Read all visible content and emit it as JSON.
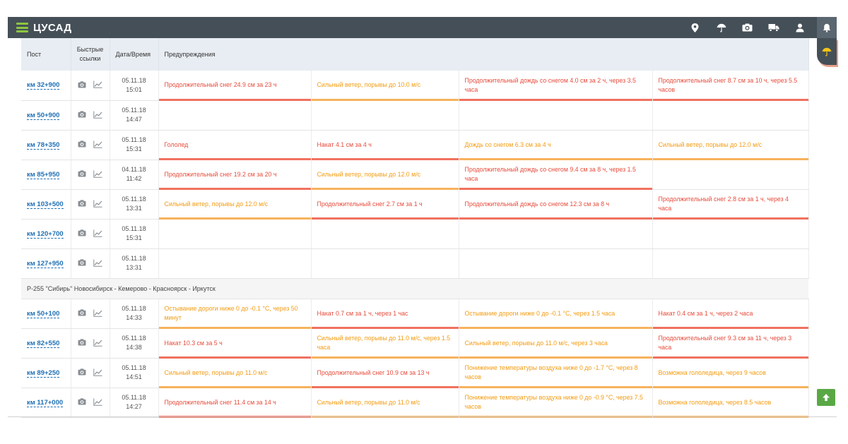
{
  "app": {
    "title": "ЦУСАД"
  },
  "topbar": {
    "icons": [
      "location-pin-icon",
      "umbrella-icon",
      "camera-icon",
      "truck-icon",
      "user-icon",
      "bell-icon"
    ]
  },
  "table": {
    "headers": {
      "post": "Пост",
      "links": "Быстрые ссылки",
      "datetime": "Дата/Время",
      "warnings": "Предупреждения"
    },
    "rows_a": [
      {
        "post": "км 32+900",
        "date": "05.11.18",
        "time": "15:01",
        "warnings": [
          {
            "text": "Продолжительный снег 24.9 см за 23 ч",
            "level": "red"
          },
          {
            "text": "Сильный ветер, порывы до 10.0 м/с",
            "level": "orange"
          },
          {
            "text": "Продолжительный дождь со снегом 4.0 см за 2 ч, через 3.5 часа",
            "level": "red"
          },
          {
            "text": "Продолжительный снег 8.7 см за 10 ч, через 5.5 часов",
            "level": "red"
          }
        ]
      },
      {
        "post": "км 50+900",
        "date": "05.11.18",
        "time": "14:47",
        "warnings": []
      },
      {
        "post": "км 78+350",
        "date": "05.11.18",
        "time": "15:31",
        "warnings": [
          {
            "text": "Гололед",
            "level": "red"
          },
          {
            "text": "Накат 4.1 см за 4 ч",
            "level": "red"
          },
          {
            "text": "Дождь со снегом 6.3 см за 4 ч",
            "level": "orange"
          },
          {
            "text": "Сильный ветер, порывы до 12.0 м/с",
            "level": "orange"
          }
        ]
      },
      {
        "post": "км 85+950",
        "date": "04.11.18",
        "time": "11:42",
        "warnings": [
          {
            "text": "Продолжительный снег 19.2 см за 20 ч",
            "level": "red"
          },
          {
            "text": "Сильный ветер, порывы до 12.0 м/с",
            "level": "orange"
          },
          {
            "text": "Продолжительный дождь со снегом 9.4 см за 8 ч, через 1.5 часа",
            "level": "red"
          }
        ]
      },
      {
        "post": "км 103+500",
        "date": "05.11.18",
        "time": "13:31",
        "warnings": [
          {
            "text": "Сильный ветер, порывы до 12.0 м/с",
            "level": "orange"
          },
          {
            "text": "Продолжительный снег 2.7 см за 1 ч",
            "level": "red"
          },
          {
            "text": "Продолжительный дождь со снегом 12.3 см за 8 ч",
            "level": "red"
          },
          {
            "text": "Продолжительный снег 2.8 см за 1 ч, через 4 часа",
            "level": "red"
          }
        ]
      },
      {
        "post": "км 120+700",
        "date": "05.11.18",
        "time": "15:31",
        "warnings": []
      },
      {
        "post": "км 127+950",
        "date": "05.11.18",
        "time": "13:31",
        "warnings": []
      }
    ],
    "section_title": "Р-255 \"Сибирь\" Новосибирск - Кемерово - Красноярск - Иркутск",
    "rows_b": [
      {
        "post": "км 50+100",
        "date": "05.11.18",
        "time": "14:33",
        "warnings": [
          {
            "text": "Остывание дороги ниже 0 до -0.1 °С, через 50 минут",
            "level": "orange"
          },
          {
            "text": "Накат 0.7 см за 1 ч, через 1 час",
            "level": "red"
          },
          {
            "text": "Остывание дороги ниже 0 до -0.1 °С, через 1.5 часа",
            "level": "orange"
          },
          {
            "text": "Накат 0.4 см за 1 ч, через 2 часа",
            "level": "red"
          }
        ]
      },
      {
        "post": "км 82+550",
        "date": "05.11.18",
        "time": "14:38",
        "warnings": [
          {
            "text": "Накат 10.3 см за 5 ч",
            "level": "red"
          },
          {
            "text": "Сильный ветер, порывы до 11.0 м/с, через 1.5 часа",
            "level": "orange"
          },
          {
            "text": "Сильный ветер, порывы до 11.0 м/с, через 3 часа",
            "level": "orange"
          },
          {
            "text": "Продолжительный снег 9.3 см за 11 ч, через 3 часа",
            "level": "red"
          }
        ]
      },
      {
        "post": "км 89+250",
        "date": "05.11.18",
        "time": "14:51",
        "warnings": [
          {
            "text": "Сильный ветер, порывы до 11.0 м/с",
            "level": "orange"
          },
          {
            "text": "Продолжительный снег 10.9 см за 13 ч",
            "level": "red"
          },
          {
            "text": "Понижение температуры воздуха ниже 0 до -1.7 °С, через 8 часов",
            "level": "orange"
          },
          {
            "text": "Возможна гололедица, через 9 часов",
            "level": "orange"
          }
        ]
      },
      {
        "post": "км 117+000",
        "date": "05.11.18",
        "time": "14:27",
        "warnings": [
          {
            "text": "Продолжительный снег 11.4 см за 14 ч",
            "level": "red"
          },
          {
            "text": "Сильный ветер, порывы до 11.0 м/с",
            "level": "orange"
          },
          {
            "text": "Понижение температуры воздуха ниже 0 до -0.9 °С, через 7.5 часов",
            "level": "orange"
          },
          {
            "text": "Возможна гололедица, через 8.5 часов",
            "level": "orange"
          }
        ]
      }
    ]
  },
  "colors": {
    "header_bg": "#454f58",
    "accent_green": "#8cc63f",
    "warn_red": "#e74c3c",
    "warn_orange": "#f39c12"
  }
}
